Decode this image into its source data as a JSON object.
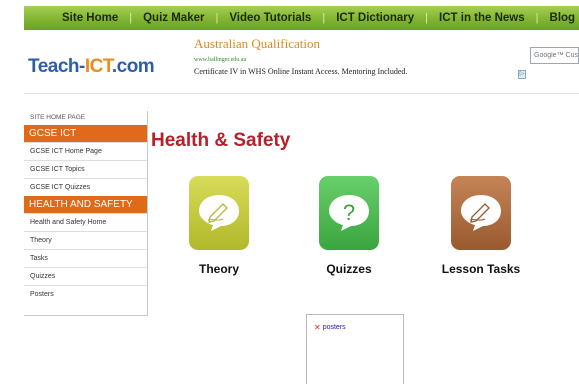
{
  "nav": {
    "items": [
      "Site Home",
      "Quiz Maker",
      "Video Tutorials",
      "ICT Dictionary",
      "ICT in the News",
      "Blog"
    ],
    "separator": "|",
    "bar_color": "#7db32e"
  },
  "logo": {
    "part1": "Teach-",
    "part2": "ICT",
    "part3": ".com"
  },
  "ad": {
    "title": "Australian Qualification",
    "url": "www.ballinger.edu.au",
    "text": "Certificate IV in WHS Online Instant Access. Mentoring Included."
  },
  "search": {
    "placeholder": "Google™ Cust"
  },
  "sidebar": {
    "site_home": "SITE HOME PAGE",
    "section1_title": "GCSE ICT",
    "section1_items": [
      "GCSE ICT Home Page",
      "GCSE ICT Topics",
      "GCSE ICT Quizzes"
    ],
    "section2_title": "HEALTH AND SAFETY",
    "section2_items": [
      "Health and Safety Home",
      "Theory",
      "Tasks",
      "Quizzes",
      "Posters"
    ],
    "accent_color": "#e06a1a"
  },
  "page": {
    "title": "Health & Safety"
  },
  "cards": [
    {
      "label": "Theory",
      "icon": "pencil-bubble-icon"
    },
    {
      "label": "Quizzes",
      "icon": "question-bubble-icon"
    },
    {
      "label": "Lesson Tasks",
      "icon": "pencil-bubble-icon"
    }
  ],
  "embedded": {
    "broken_image_alt": "posters"
  }
}
